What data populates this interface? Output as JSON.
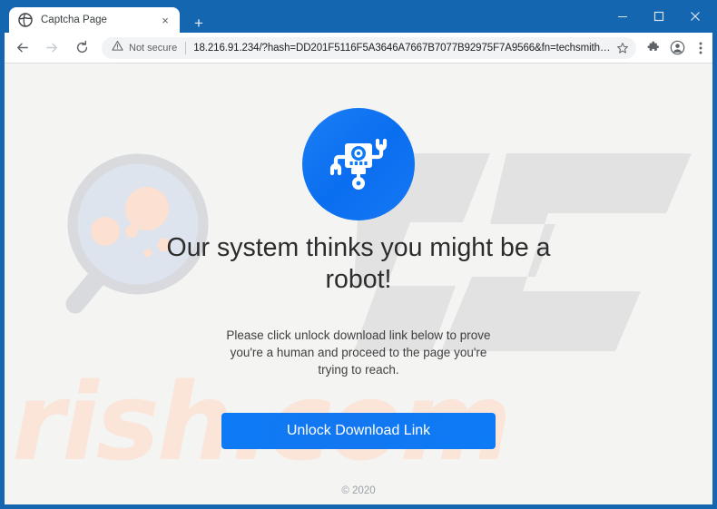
{
  "browser": {
    "tab": {
      "title": "Captcha Page",
      "favicon": "globe-icon",
      "close": "×"
    },
    "new_tab_label": "+",
    "window_controls": {
      "minimize": "minimize-icon",
      "maximize": "maximize-icon",
      "close": "close-icon"
    },
    "nav": {
      "back": "back-arrow-icon",
      "forward": "forward-arrow-icon",
      "reload": "reload-icon"
    },
    "omnibox": {
      "security_icon": "warning-triangle-icon",
      "security_label": "Not secure",
      "url": "18.216.91.234/?hash=DD201F5116F5A3646A7667B7077B92975F7A9566&fn=techsmith-camtasia-stu...",
      "star_icon": "star-icon"
    },
    "toolbar_icons": {
      "extensions": "puzzle-icon",
      "profile": "profile-avatar-icon",
      "menu": "three-dot-menu-icon"
    },
    "frame_color": "#1566b0"
  },
  "page": {
    "brand_icon": "robot-icon",
    "headline": "Our system thinks you might be a robot!",
    "subtext": "Please click unlock download link below to prove you're a human and proceed to the page you're trying to reach.",
    "cta_label": "Unlock Download Link",
    "copyright": "© 2020",
    "accent_color": "#0d7bf7",
    "background_color": "#f4f4f3",
    "watermarks": {
      "magnifier": "magnifying-glass-watermark",
      "pc_logo": "pc-logo-watermark",
      "site_text": "rish.com",
      "site_text_color": "#fbe4d8"
    }
  }
}
